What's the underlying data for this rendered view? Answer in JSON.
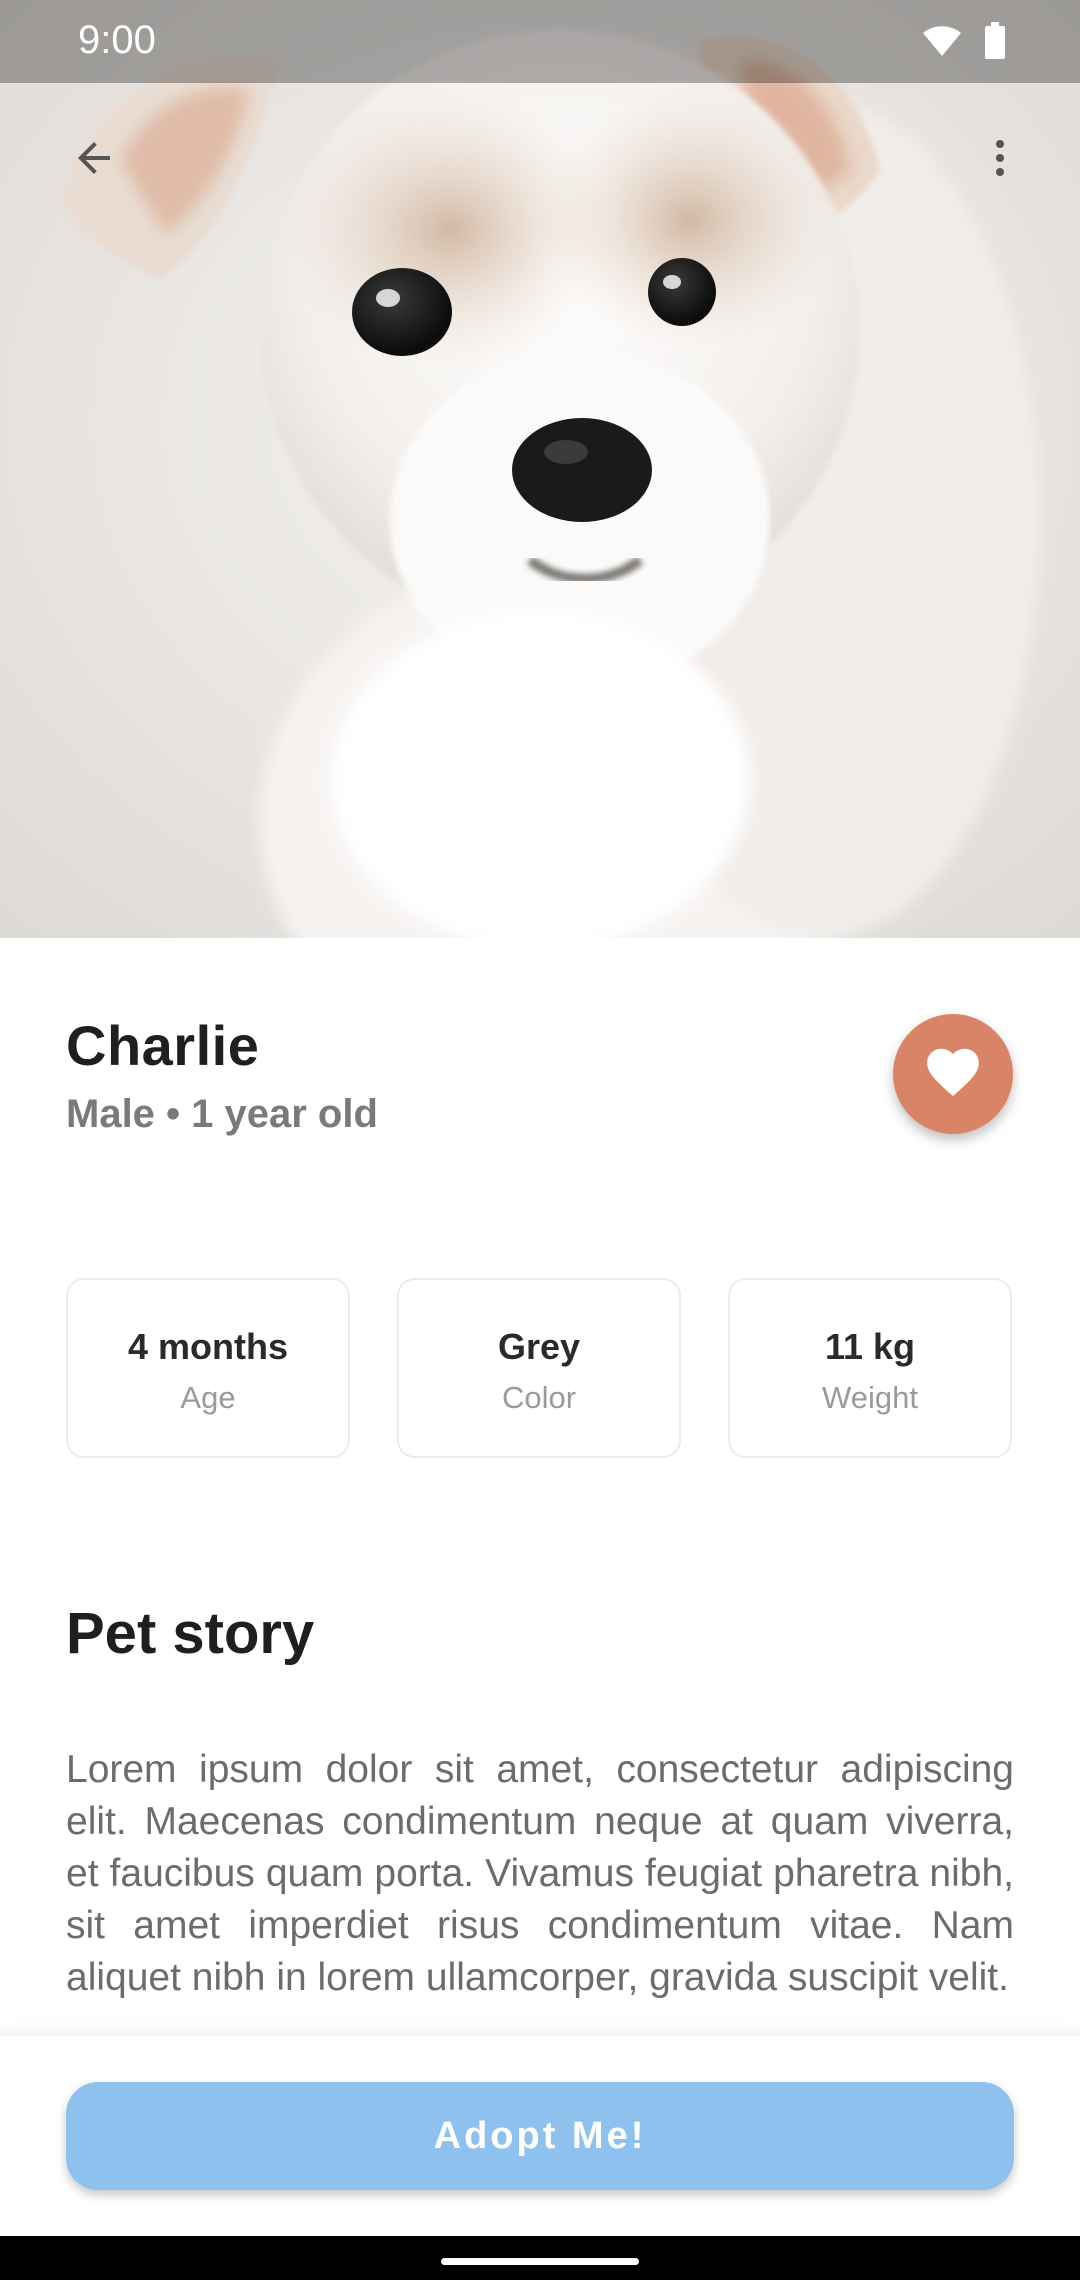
{
  "status_bar": {
    "time": "9:00",
    "icons": [
      "wifi-icon",
      "battery-icon"
    ]
  },
  "toolbar": {
    "back_icon": "arrow-back-icon",
    "more_icon": "more-vert-icon"
  },
  "hero": {
    "image": "puppy-photo"
  },
  "pet": {
    "name": "Charlie",
    "subtitle": "Male • 1 year old",
    "favorite_icon": "heart-icon"
  },
  "stats": [
    {
      "value": "4 months",
      "label": "Age"
    },
    {
      "value": "Grey",
      "label": "Color"
    },
    {
      "value": "11 kg",
      "label": "Weight"
    }
  ],
  "story": {
    "title": "Pet story",
    "text": "Lorem ipsum dolor sit amet, consectetur adipiscing elit. Maecenas condimentum neque at quam viverra, et faucibus quam porta. Vivamus feugiat pharetra nibh, sit amet imperdiet risus condimentum vitae. Nam aliquet nibh in lorem ullamcorper, gravida suscipit velit."
  },
  "action": {
    "adopt_label": "Adopt Me!"
  },
  "colors": {
    "accent": "#d98466",
    "adopt_button": "#8fc1ef",
    "title_text": "#1f1f1f",
    "secondary_text": "#7a7a7a"
  }
}
